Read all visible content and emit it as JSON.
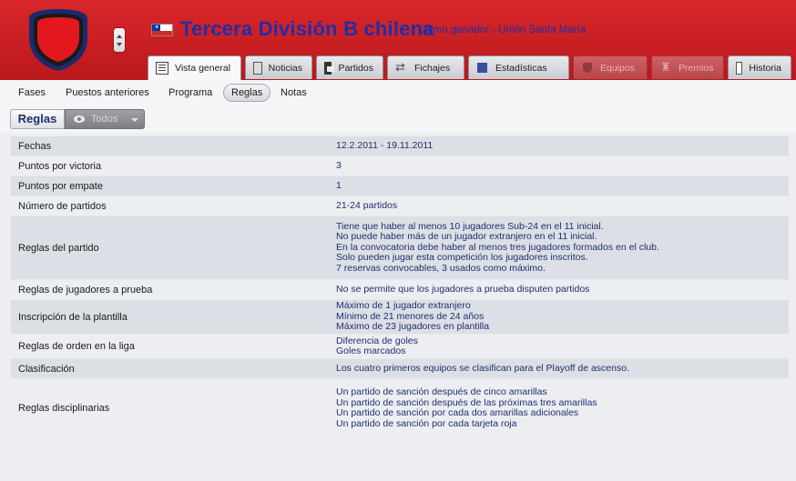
{
  "header": {
    "title": "Tercera División B chilena",
    "subtitle": "Último ganador - Unión Santa María"
  },
  "tabs": [
    {
      "label": "Vista general",
      "icon": "list-icon",
      "state": "active"
    },
    {
      "label": "Noticias",
      "icon": "news-icon",
      "state": "normal"
    },
    {
      "label": "Partidos",
      "icon": "calendar-icon",
      "state": "normal"
    },
    {
      "label": "Fichajes",
      "icon": "transfer-icon",
      "state": "normal"
    },
    {
      "label": "Estadísticas",
      "icon": "stats-icon",
      "state": "normal"
    },
    {
      "label": "Equipos",
      "icon": "shield-icon",
      "state": "disabled"
    },
    {
      "label": "Premios",
      "icon": "trophy-icon",
      "state": "disabled"
    },
    {
      "label": "Historia",
      "icon": "document-icon",
      "state": "normal"
    }
  ],
  "subnav": [
    "Fases",
    "Puestos anteriores",
    "Programa",
    "Reglas",
    "Notas"
  ],
  "subnav_selected": "Reglas",
  "toolbar": {
    "section": "Reglas",
    "filter": "Todos"
  },
  "rules": [
    {
      "label": "Fechas",
      "lines": [
        "12.2.2011 - 19.11.2011"
      ]
    },
    {
      "label": "Puntos por victoria",
      "lines": [
        "3"
      ]
    },
    {
      "label": "Puntos por empate",
      "lines": [
        "1"
      ]
    },
    {
      "label": "Número de partidos",
      "lines": [
        "21-24 partidos"
      ]
    },
    {
      "label": "Reglas del partido",
      "lines": [
        "Tiene que haber al menos 10 jugadores Sub-24 en el 11 inicial.",
        "No puede haber más de un jugador extranjero en el 11 inicial.",
        "En la convocatoria debe haber al menos tres jugadores formados en el club.",
        "Solo pueden jugar esta competición los jugadores inscritos.",
        "7 reservas convocables, 3 usados como máximo."
      ]
    },
    {
      "label": "Reglas de jugadores a prueba",
      "lines": [
        "No se permite que los jugadores a prueba disputen partidos"
      ]
    },
    {
      "label": "Inscripción de la plantilla",
      "lines": [
        "Máximo de 1 jugador extranjero",
        "Mínimo de 21 menores de 24 años",
        "Máximo de 23 jugadores en plantilla"
      ]
    },
    {
      "label": "Reglas de orden en la liga",
      "lines": [
        "Diferencia de goles",
        "Goles marcados"
      ]
    },
    {
      "label": "Clasificación",
      "lines": [
        "Los cuatro primeros equipos se clasifican para el Playoff de ascenso."
      ]
    },
    {
      "label": "Reglas disciplinarias",
      "lines": [
        "Un partido de sanción después de cinco amarillas",
        "Un partido de sanción después de las próximas tres amarillas",
        "Un partido de sanción por cada dos amarillas adicionales",
        "Un partido de sanción por cada tarjeta roja"
      ]
    }
  ]
}
